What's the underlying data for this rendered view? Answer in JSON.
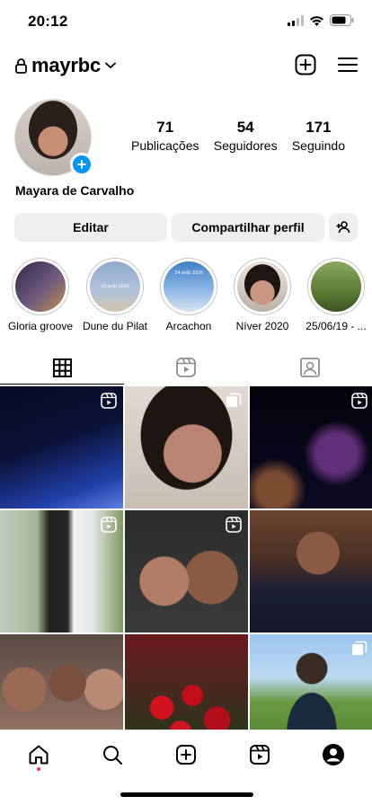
{
  "status_bar": {
    "time": "20:12"
  },
  "header": {
    "username": "mayrbc"
  },
  "profile": {
    "full_name": "Mayara de Carvalho",
    "stats": [
      {
        "value": "71",
        "label": "Publicações"
      },
      {
        "value": "54",
        "label": "Seguidores"
      },
      {
        "value": "171",
        "label": "Seguindo"
      }
    ]
  },
  "buttons": {
    "edit": "Editar",
    "share": "Compartilhar perfil"
  },
  "highlights": [
    {
      "label": "Gloria groove",
      "color": "#6d5a7d"
    },
    {
      "label": "Dune du Pilat",
      "color": "#7f9bc2",
      "overlay": "26 août 2020"
    },
    {
      "label": "Arcachon",
      "color": "#4b88c9",
      "overlay": "24 août 2020"
    },
    {
      "label": "Níver 2020",
      "color": "#3b2a23"
    },
    {
      "label": "25/06/19 - ...",
      "color": "#6c8a45"
    }
  ],
  "tabs": [
    {
      "name": "grid-tab",
      "icon": "grid-icon"
    },
    {
      "name": "reels-tab",
      "icon": "reels-icon"
    },
    {
      "name": "tagged-tab",
      "icon": "tagged-icon"
    }
  ],
  "grid": [
    {
      "badge": "reels",
      "colors": [
        "#0b1237",
        "#2140a8"
      ]
    },
    {
      "badge": "carousel",
      "colors": [
        "#c9b2a6",
        "#6b4b3e"
      ]
    },
    {
      "badge": "reels",
      "colors": [
        "#060613",
        "#3a1a4e"
      ]
    },
    {
      "badge": "reels",
      "colors": [
        "#bfc7b9",
        "#3c4b2e"
      ]
    },
    {
      "badge": "reels",
      "colors": [
        "#2b2b2b",
        "#9a7461"
      ]
    },
    {
      "badge": "",
      "colors": [
        "#5a3b2c",
        "#1f1f2e"
      ]
    },
    {
      "badge": "",
      "colors": [
        "#4b3a33",
        "#a17b6b"
      ]
    },
    {
      "badge": "",
      "colors": [
        "#b20e1a",
        "#1f3a1a"
      ]
    },
    {
      "badge": "carousel",
      "colors": [
        "#8bbae6",
        "#5e8d3c"
      ]
    }
  ],
  "bottom_nav": [
    {
      "name": "home",
      "icon": "home-icon"
    },
    {
      "name": "search",
      "icon": "search-icon"
    },
    {
      "name": "create",
      "icon": "add-post-icon"
    },
    {
      "name": "reels",
      "icon": "reels-icon"
    },
    {
      "name": "profile",
      "icon": "profile-icon"
    }
  ]
}
